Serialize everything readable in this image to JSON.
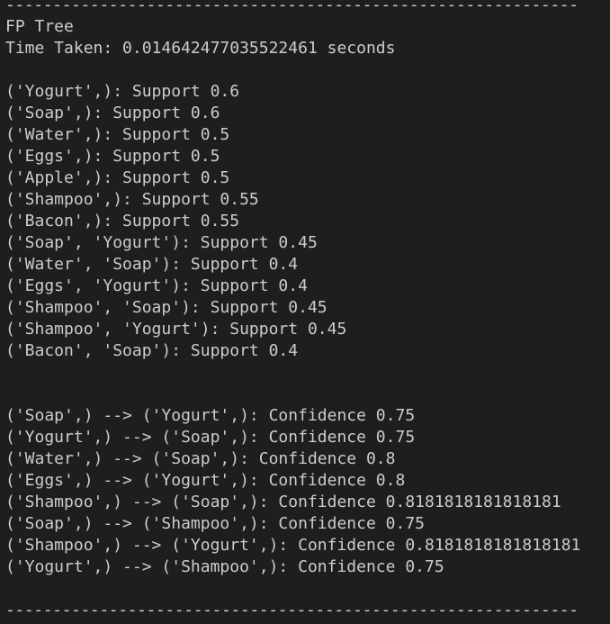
{
  "terminal": {
    "separator_top": "-------------------------------------------------------------",
    "title": "FP Tree",
    "time_taken": "Time Taken: 0.014642477035522461 seconds",
    "support_lines": [
      "('Yogurt',): Support 0.6",
      "('Soap',): Support 0.6",
      "('Water',): Support 0.5",
      "('Eggs',): Support 0.5",
      "('Apple',): Support 0.5",
      "('Shampoo',): Support 0.55",
      "('Bacon',): Support 0.55",
      "('Soap', 'Yogurt'): Support 0.45",
      "('Water', 'Soap'): Support 0.4",
      "('Eggs', 'Yogurt'): Support 0.4",
      "('Shampoo', 'Soap'): Support 0.45",
      "('Shampoo', 'Yogurt'): Support 0.45",
      "('Bacon', 'Soap'): Support 0.4"
    ],
    "confidence_lines": [
      "('Soap',) --> ('Yogurt',): Confidence 0.75",
      "('Yogurt',) --> ('Soap',): Confidence 0.75",
      "('Water',) --> ('Soap',): Confidence 0.8",
      "('Eggs',) --> ('Yogurt',): Confidence 0.8",
      "('Shampoo',) --> ('Soap',): Confidence 0.8181818181818181",
      "('Soap',) --> ('Shampoo',): Confidence 0.75",
      "('Shampoo',) --> ('Yogurt',): Confidence 0.8181818181818181",
      "('Yogurt',) --> ('Shampoo',): Confidence 0.75"
    ],
    "separator_bottom": "-------------------------------------------------------------"
  }
}
